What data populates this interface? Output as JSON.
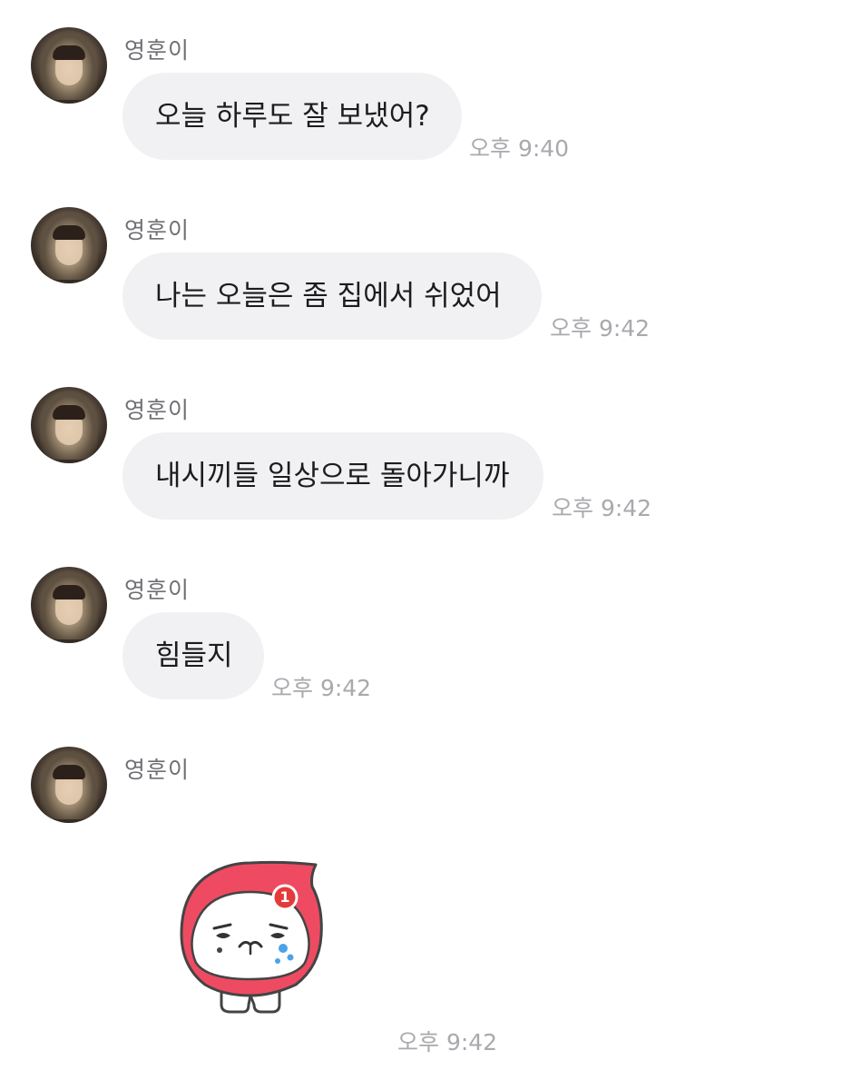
{
  "conversation": {
    "messages": [
      {
        "sender": "영훈이",
        "text": "오늘 하루도 잘 보냈어?",
        "time": "오후 9:40"
      },
      {
        "sender": "영훈이",
        "text": "나는 오늘은 좀 집에서 쉬었어",
        "time": "오후 9:42"
      },
      {
        "sender": "영훈이",
        "text": "내시끼들 일상으로 돌아가니까",
        "time": "오후 9:42"
      },
      {
        "sender": "영훈이",
        "text": "힘들지",
        "time": "오후 9:42"
      }
    ],
    "sticker_message": {
      "sender": "영훈이",
      "sticker": "crying-character-sticker",
      "badge": "1",
      "time": "오후 9:42"
    }
  },
  "colors": {
    "bubble": "#f1f1f3",
    "timestamp": "#a9a9ae",
    "sticker_hood": "#ee4b63"
  }
}
